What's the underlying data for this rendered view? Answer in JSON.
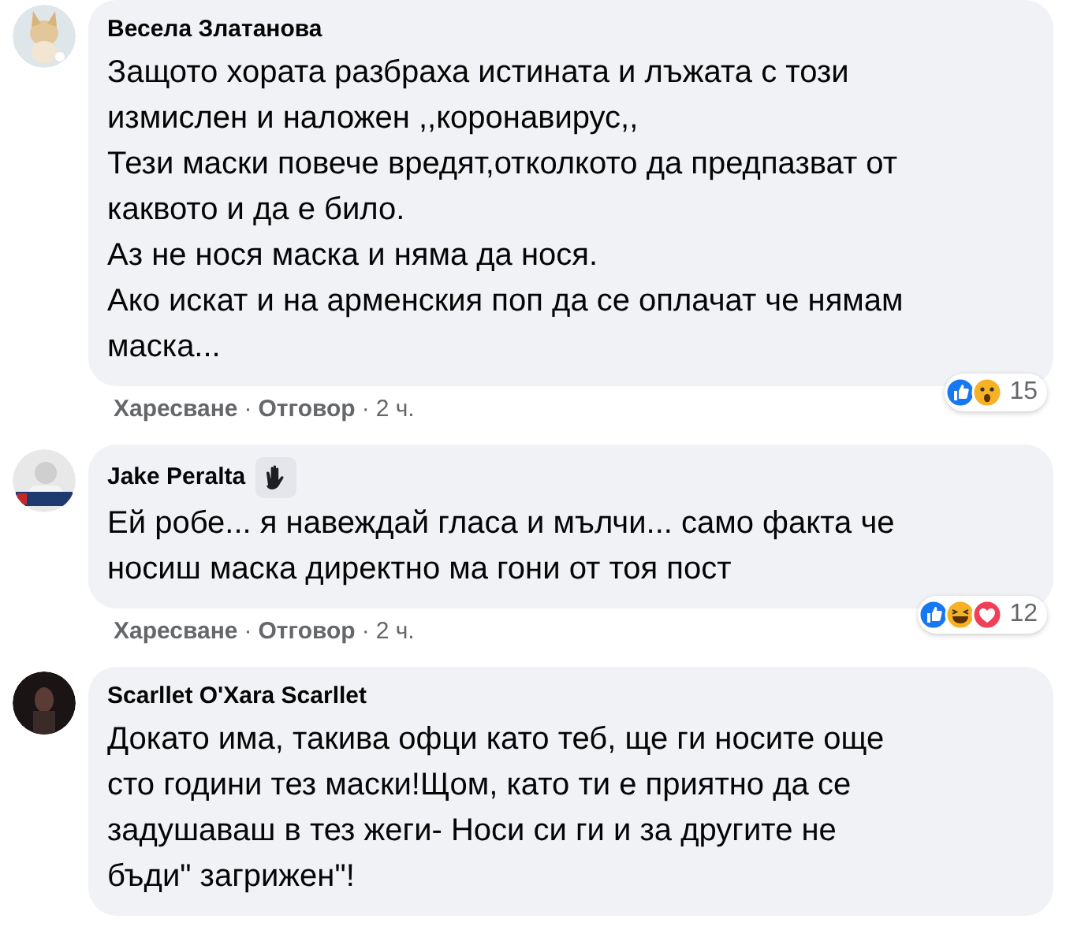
{
  "comments": [
    {
      "author": "Весела Златанова",
      "avatar": {
        "kind": "dog"
      },
      "badge": false,
      "lines": [
        "Защото хората разбраха истината и лъжата с този",
        "измислен и наложен ,,коронавирус,,",
        "Тези маски повече вредят,отколкото да предпазват от",
        "каквото и да е било.",
        "Аз не нося маска и няма да нося.",
        "Ако искат и на арменския поп да се оплачат че нямам",
        "маска..."
      ],
      "reactions": {
        "icons": [
          {
            "kind": "like"
          },
          {
            "kind": "wow"
          }
        ],
        "count": "15"
      },
      "actions": [
        {
          "kind": "link",
          "text": "Харесване"
        },
        {
          "kind": "separator",
          "text": "·"
        },
        {
          "kind": "link",
          "text": "Отговор"
        },
        {
          "kind": "separator",
          "text": "·"
        },
        {
          "kind": "time",
          "text": "2 ч."
        }
      ]
    },
    {
      "author": "Jake Peralta",
      "avatar": {
        "kind": "person"
      },
      "badge": true,
      "lines": [
        "Ей робе... я навеждай гласа и мълчи... само факта че",
        "носиш маска директно ма гони от тоя пост"
      ],
      "reactions": {
        "icons": [
          {
            "kind": "like"
          },
          {
            "kind": "haha"
          },
          {
            "kind": "love"
          }
        ],
        "count": "12"
      },
      "actions": [
        {
          "kind": "link",
          "text": "Харесване"
        },
        {
          "kind": "separator",
          "text": "·"
        },
        {
          "kind": "link",
          "text": "Отговор"
        },
        {
          "kind": "separator",
          "text": "·"
        },
        {
          "kind": "time",
          "text": "2 ч."
        }
      ]
    },
    {
      "author": "Scarllet O'Xara Scarllet",
      "avatar": {
        "kind": "dark"
      },
      "badge": false,
      "lines": [
        "Докато има, такива офци като теб, ще ги носите още",
        "сто години тез маски!Щом, като ти е приятно да се",
        "задушаваш в тез жеги- Носи си ги и за другите не",
        "бъди\" загрижен\"!"
      ]
    }
  ]
}
